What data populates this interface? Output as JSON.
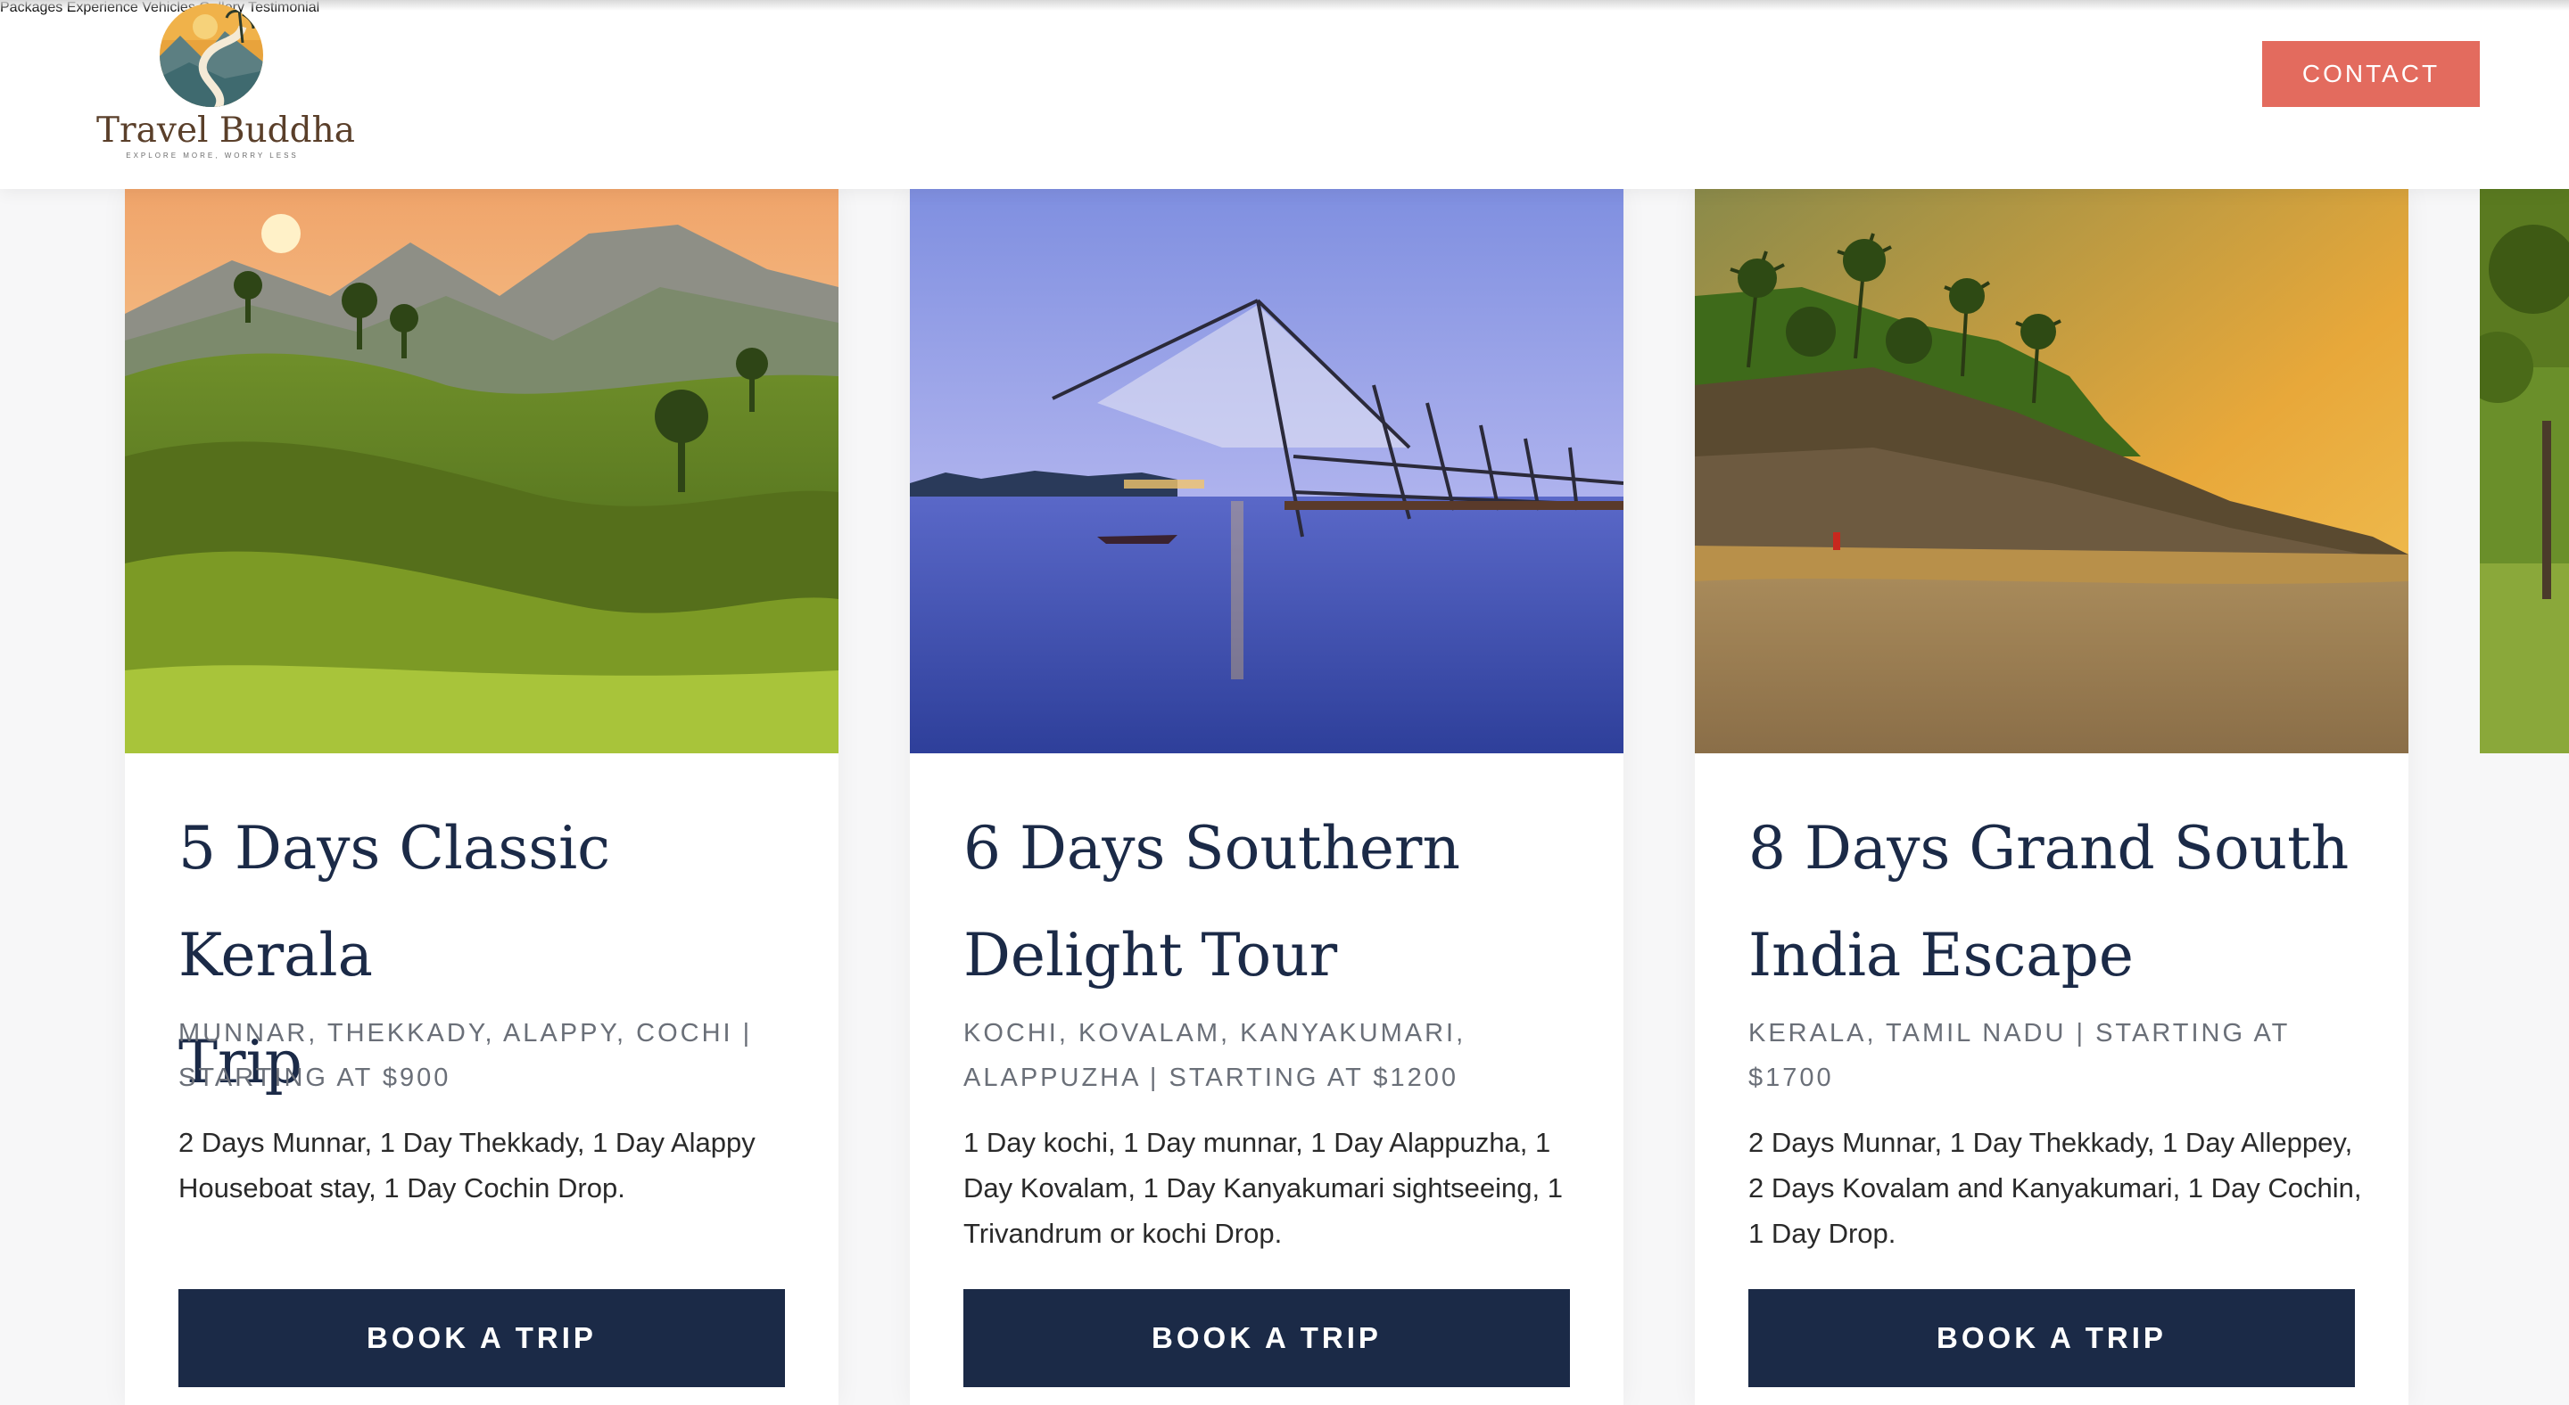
{
  "brand": {
    "name": "Travel Buddha",
    "tagline": "EXPLORE MORE, WORRY LESS"
  },
  "nav": {
    "items": [
      {
        "label": "Packages"
      },
      {
        "label": "Experience"
      },
      {
        "label": "Vehicles"
      },
      {
        "label": "Gallery"
      },
      {
        "label": "Testimonial"
      }
    ],
    "contact_label": "CONTACT"
  },
  "colors": {
    "accent": "#e36b5e",
    "primary": "#1b2a47",
    "muted": "#6a6f78"
  },
  "cards": [
    {
      "title_line1": "5 Days Classic Kerala",
      "title_line2": "Trip",
      "meta_line1": "MUNNAR, THEKKADY, ALAPPY, COCHI |",
      "meta_line2": "STARTING AT $900",
      "desc_line1": "2 Days Munnar, 1 Day Thekkady, 1 Day Alappy",
      "desc_line2": "Houseboat stay, 1 Day Cochin Drop.",
      "desc_line3": "",
      "button_label": "BOOK A TRIP",
      "image_icon": "tea-plantation-image"
    },
    {
      "title_line1": "6 Days Southern",
      "title_line2": "Delight Tour",
      "meta_line1": "KOCHI, KOVALAM, KANYAKUMARI,",
      "meta_line2": "ALAPPUZHA | STARTING AT $1200",
      "desc_line1": "1 Day kochi, 1 Day munnar, 1 Day Alappuzha, 1",
      "desc_line2": "Day Kovalam, 1 Day Kanyakumari sightseeing, 1",
      "desc_line3": "Trivandrum or kochi Drop.",
      "button_label": "BOOK A TRIP",
      "image_icon": "fishing-nets-image"
    },
    {
      "title_line1": "8 Days Grand South",
      "title_line2": "India Escape",
      "meta_line1": "KERALA, TAMIL NADU | STARTING AT",
      "meta_line2": "$1700",
      "desc_line1": "2 Days Munnar, 1 Day Thekkady, 1 Day Alleppey,",
      "desc_line2": "2 Days Kovalam and Kanyakumari, 1 Day Cochin,",
      "desc_line3": "1 Day Drop.",
      "button_label": "BOOK A TRIP",
      "image_icon": "beach-sunset-image"
    }
  ]
}
